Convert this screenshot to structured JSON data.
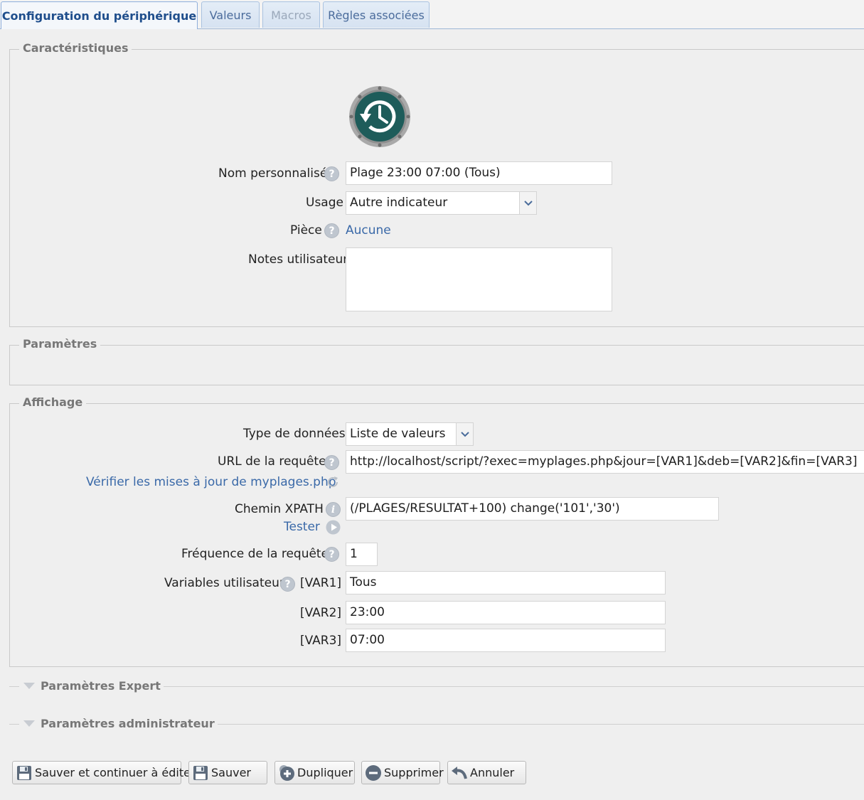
{
  "tabs": [
    {
      "label": "Configuration du périphérique",
      "state": "active"
    },
    {
      "label": "Valeurs",
      "state": "normal"
    },
    {
      "label": "Macros",
      "state": "disabled"
    },
    {
      "label": "Règles associées",
      "state": "normal"
    }
  ],
  "characteristics": {
    "legend": "Caractéristiques",
    "device_icon": "clock-history-icon",
    "name_label": "Nom personnalisé",
    "name_value": "Plage 23:00 07:00 (Tous)",
    "usage_label": "Usage",
    "usage_value": "Autre indicateur",
    "room_label": "Pièce",
    "room_value": "Aucune",
    "notes_label": "Notes utilisateur",
    "notes_value": ""
  },
  "parameters": {
    "legend": "Paramètres"
  },
  "display": {
    "legend": "Affichage",
    "data_type_label": "Type de données",
    "data_type_value": "Liste de valeurs",
    "url_label": "URL de la requête",
    "url_value": "http://localhost/script/?exec=myplages.php&jour=[VAR1]&deb=[VAR2]&fin=[VAR3]",
    "check_updates_link": "Vérifier les mises à jour de myplages.php",
    "xpath_label": "Chemin XPATH",
    "xpath_value": "(/PLAGES/RESULTAT+100) change('101','30')",
    "test_link": "Tester",
    "frequency_label": "Fréquence de la requête",
    "frequency_value": "1",
    "user_vars_label": "Variables utilisateur",
    "vars": [
      {
        "name": "[VAR1]",
        "value": "Tous"
      },
      {
        "name": "[VAR2]",
        "value": "23:00"
      },
      {
        "name": "[VAR3]",
        "value": "07:00"
      }
    ]
  },
  "expert": {
    "label": "Paramètres Expert"
  },
  "admin": {
    "label": "Paramètres administrateur"
  },
  "buttons": {
    "save_continue": "Sauver et continuer à éditer",
    "save": "Sauver",
    "duplicate": "Dupliquer",
    "delete": "Supprimer",
    "cancel": "Annuler"
  },
  "colors": {
    "link": "#3a69a8",
    "tab_active_text": "#1f4e8c",
    "icon_teal": "#1e5c5a"
  }
}
